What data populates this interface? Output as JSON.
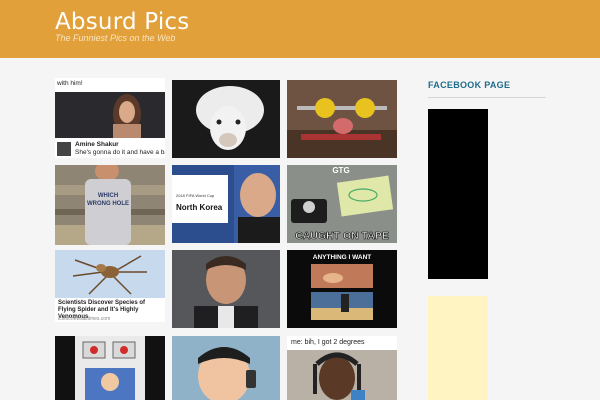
{
  "site": {
    "title": "Absurd Pics",
    "tagline": "The Funniest Pics on the Web"
  },
  "sidebar": {
    "facebook_title": "FACEBOOK PAGE"
  },
  "tiles": {
    "kim": {
      "top_text": "with him!",
      "author": "Amine Shakur",
      "post_text": "She's gonna do it and have a baby with himm!"
    },
    "north_korea": {
      "sign_small": "2018 FIFA World Cup",
      "sign_text": "North Korea"
    },
    "spider": {
      "headline": "Scientists Discover Species of Flying Spider and It's Highly Venomous",
      "source": "iconicnewsalltimes.com"
    },
    "shirt": {
      "shirt_text_1": "WHICH",
      "shirt_text_2": "WRONG HOLE"
    },
    "caught": {
      "top_text": "GTG",
      "bottom_text": "CAUGHT ON TAPE"
    },
    "anything": {
      "top_text": "ANYTHING I WANT"
    },
    "degrees": {
      "top_text": "me: bih, I got 2 degrees"
    }
  }
}
